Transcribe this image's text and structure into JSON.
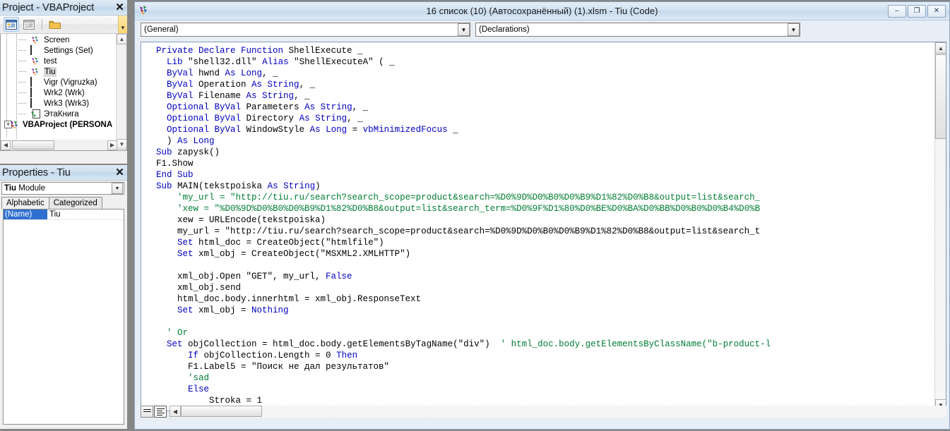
{
  "project_pane": {
    "title": "Project - VBAProject",
    "close_label": "✕",
    "toolbar": {
      "view_code_icon": "view-code-icon",
      "view_object_icon": "view-object-icon",
      "toggle_folders_icon": "folder-icon",
      "overflow_label": "▼"
    },
    "tree": [
      {
        "label": "Screen",
        "icon": "class-module-icon",
        "selected": false,
        "bold": false,
        "level": 1
      },
      {
        "label": "Settings (Set)",
        "icon": "worksheet-icon",
        "selected": false,
        "bold": false,
        "level": 1
      },
      {
        "label": "test",
        "icon": "class-module-icon",
        "selected": false,
        "bold": false,
        "level": 1
      },
      {
        "label": "Tiu",
        "icon": "class-module-icon",
        "selected": true,
        "bold": false,
        "level": 1
      },
      {
        "label": "Vigr (Vigruzka)",
        "icon": "worksheet-icon",
        "selected": false,
        "bold": false,
        "level": 1
      },
      {
        "label": "Wrk2 (Wrk)",
        "icon": "worksheet-icon",
        "selected": false,
        "bold": false,
        "level": 1
      },
      {
        "label": "Wrk3 (Wrk3)",
        "icon": "worksheet-icon",
        "selected": false,
        "bold": false,
        "level": 1
      },
      {
        "label": "ЭтаКнига",
        "icon": "workbook-icon",
        "selected": false,
        "bold": false,
        "level": 1
      },
      {
        "label": "VBAProject (PERSONA",
        "icon": "vbaproject-icon",
        "selected": false,
        "bold": true,
        "level": 0,
        "expander": "+"
      }
    ]
  },
  "properties_pane": {
    "title": "Properties - Tiu",
    "close_label": "✕",
    "object_name": "Tiu",
    "object_type": "Module",
    "dropdown_arrow": "▼",
    "tabs": [
      {
        "label": "Alphabetic",
        "active": true
      },
      {
        "label": "Categorized",
        "active": false
      }
    ],
    "rows": [
      {
        "key": "(Name)",
        "value": "Tiu"
      }
    ]
  },
  "code_window": {
    "title": "16 список (10) (Автосохранённый) (1).xlsm - Tiu (Code)",
    "app_icon": "vba-module-icon",
    "buttons": {
      "minimize": "–",
      "restore": "❐",
      "close": "✕"
    },
    "combo_left": {
      "value": "(General)",
      "arrow": "▼"
    },
    "combo_right": {
      "value": "(Declarations)",
      "arrow": "▼"
    },
    "view_buttons": {
      "procedure_view": "procedure-view-icon",
      "full_module_view": "full-module-view-icon"
    },
    "scroll": {
      "up_arrow": "▲",
      "down_arrow": "▼",
      "left_arrow": "◀",
      "right_arrow": "▶"
    },
    "code_lines": [
      [
        {
          "t": "  ",
          "c": ""
        },
        {
          "t": "Private Declare Function",
          "c": "kw"
        },
        {
          "t": " ShellExecute _",
          "c": ""
        }
      ],
      [
        {
          "t": "    ",
          "c": ""
        },
        {
          "t": "Lib",
          "c": "kw"
        },
        {
          "t": " \"shell32.dll\" ",
          "c": ""
        },
        {
          "t": "Alias",
          "c": "kw"
        },
        {
          "t": " \"ShellExecuteA\" ( _",
          "c": ""
        }
      ],
      [
        {
          "t": "    ",
          "c": ""
        },
        {
          "t": "ByVal",
          "c": "kw"
        },
        {
          "t": " hwnd ",
          "c": ""
        },
        {
          "t": "As Long",
          "c": "kw"
        },
        {
          "t": ", _",
          "c": ""
        }
      ],
      [
        {
          "t": "    ",
          "c": ""
        },
        {
          "t": "ByVal",
          "c": "kw"
        },
        {
          "t": " Operation ",
          "c": ""
        },
        {
          "t": "As String",
          "c": "kw"
        },
        {
          "t": ", _",
          "c": ""
        }
      ],
      [
        {
          "t": "    ",
          "c": ""
        },
        {
          "t": "ByVal",
          "c": "kw"
        },
        {
          "t": " Filename ",
          "c": ""
        },
        {
          "t": "As String",
          "c": "kw"
        },
        {
          "t": ", _",
          "c": ""
        }
      ],
      [
        {
          "t": "    ",
          "c": ""
        },
        {
          "t": "Optional ByVal",
          "c": "kw"
        },
        {
          "t": " Parameters ",
          "c": ""
        },
        {
          "t": "As String",
          "c": "kw"
        },
        {
          "t": ", _",
          "c": ""
        }
      ],
      [
        {
          "t": "    ",
          "c": ""
        },
        {
          "t": "Optional ByVal",
          "c": "kw"
        },
        {
          "t": " Directory ",
          "c": ""
        },
        {
          "t": "As String",
          "c": "kw"
        },
        {
          "t": ", _",
          "c": ""
        }
      ],
      [
        {
          "t": "    ",
          "c": ""
        },
        {
          "t": "Optional ByVal",
          "c": "kw"
        },
        {
          "t": " WindowStyle ",
          "c": ""
        },
        {
          "t": "As Long",
          "c": "kw"
        },
        {
          "t": " = ",
          "c": ""
        },
        {
          "t": "vbMinimizedFocus",
          "c": "kw"
        },
        {
          "t": " _",
          "c": ""
        }
      ],
      [
        {
          "t": "    ) ",
          "c": ""
        },
        {
          "t": "As Long",
          "c": "kw"
        }
      ],
      [
        {
          "t": "  ",
          "c": ""
        },
        {
          "t": "Sub",
          "c": "kw"
        },
        {
          "t": " zapysk()",
          "c": ""
        }
      ],
      [
        {
          "t": "  F1.Show",
          "c": ""
        }
      ],
      [
        {
          "t": "  ",
          "c": ""
        },
        {
          "t": "End Sub",
          "c": "kw"
        }
      ],
      [
        {
          "t": "  ",
          "c": ""
        },
        {
          "t": "Sub",
          "c": "kw"
        },
        {
          "t": " MAIN(tekstpoiska ",
          "c": ""
        },
        {
          "t": "As String",
          "c": "kw"
        },
        {
          "t": ")",
          "c": ""
        }
      ],
      [
        {
          "t": "      ",
          "c": ""
        },
        {
          "t": "'my_url = \"http://tiu.ru/search?search_scope=product&search=%D0%9D%D0%B0%D0%B9%D1%82%D0%B8&output=list&search_",
          "c": "cm"
        }
      ],
      [
        {
          "t": "      ",
          "c": ""
        },
        {
          "t": "'xew = \"%D0%9D%D0%B0%D0%B9%D1%82%D0%B8&output=list&search_term=%D0%9F%D1%80%D0%BE%D0%BA%D0%BB%D0%B0%D0%B4%D0%B",
          "c": "cm"
        }
      ],
      [
        {
          "t": "      xew = URLEncode(tekstpoiska)",
          "c": ""
        }
      ],
      [
        {
          "t": "      my_url = \"http://tiu.ru/search?search_scope=product&search=%D0%9D%D0%B0%D0%B9%D1%82%D0%B8&output=list&search_t",
          "c": ""
        }
      ],
      [
        {
          "t": "      ",
          "c": ""
        },
        {
          "t": "Set",
          "c": "kw"
        },
        {
          "t": " html_doc = CreateObject(\"htmlfile\")",
          "c": ""
        }
      ],
      [
        {
          "t": "      ",
          "c": ""
        },
        {
          "t": "Set",
          "c": "kw"
        },
        {
          "t": " xml_obj = CreateObject(\"MSXML2.XMLHTTP\")",
          "c": ""
        }
      ],
      [
        {
          "t": "",
          "c": ""
        }
      ],
      [
        {
          "t": "      xml_obj.Open \"GET\", my_url, ",
          "c": ""
        },
        {
          "t": "False",
          "c": "kw"
        }
      ],
      [
        {
          "t": "      xml_obj.send",
          "c": ""
        }
      ],
      [
        {
          "t": "      html_doc.body.innerhtml = xml_obj.ResponseText",
          "c": ""
        }
      ],
      [
        {
          "t": "      ",
          "c": ""
        },
        {
          "t": "Set",
          "c": "kw"
        },
        {
          "t": " xml_obj = ",
          "c": ""
        },
        {
          "t": "Nothing",
          "c": "kw"
        }
      ],
      [
        {
          "t": "",
          "c": ""
        }
      ],
      [
        {
          "t": "    ",
          "c": ""
        },
        {
          "t": "' Or",
          "c": "cm"
        }
      ],
      [
        {
          "t": "    ",
          "c": ""
        },
        {
          "t": "Set",
          "c": "kw"
        },
        {
          "t": " objCollection = html_doc.body.getElementsByTagName(\"div\")  ",
          "c": ""
        },
        {
          "t": "' html_doc.body.getElementsByClassName(\"b-product-l",
          "c": "cm"
        }
      ],
      [
        {
          "t": "        ",
          "c": ""
        },
        {
          "t": "If",
          "c": "kw"
        },
        {
          "t": " objCollection.Length = 0 ",
          "c": ""
        },
        {
          "t": "Then",
          "c": "kw"
        }
      ],
      [
        {
          "t": "        F1.Label5 = \"Поиск не дал результатов\"",
          "c": ""
        }
      ],
      [
        {
          "t": "        ",
          "c": ""
        },
        {
          "t": "'sad",
          "c": "cm"
        }
      ],
      [
        {
          "t": "        ",
          "c": ""
        },
        {
          "t": "Else",
          "c": "kw"
        }
      ],
      [
        {
          "t": "            Stroka = 1",
          "c": ""
        }
      ]
    ]
  }
}
